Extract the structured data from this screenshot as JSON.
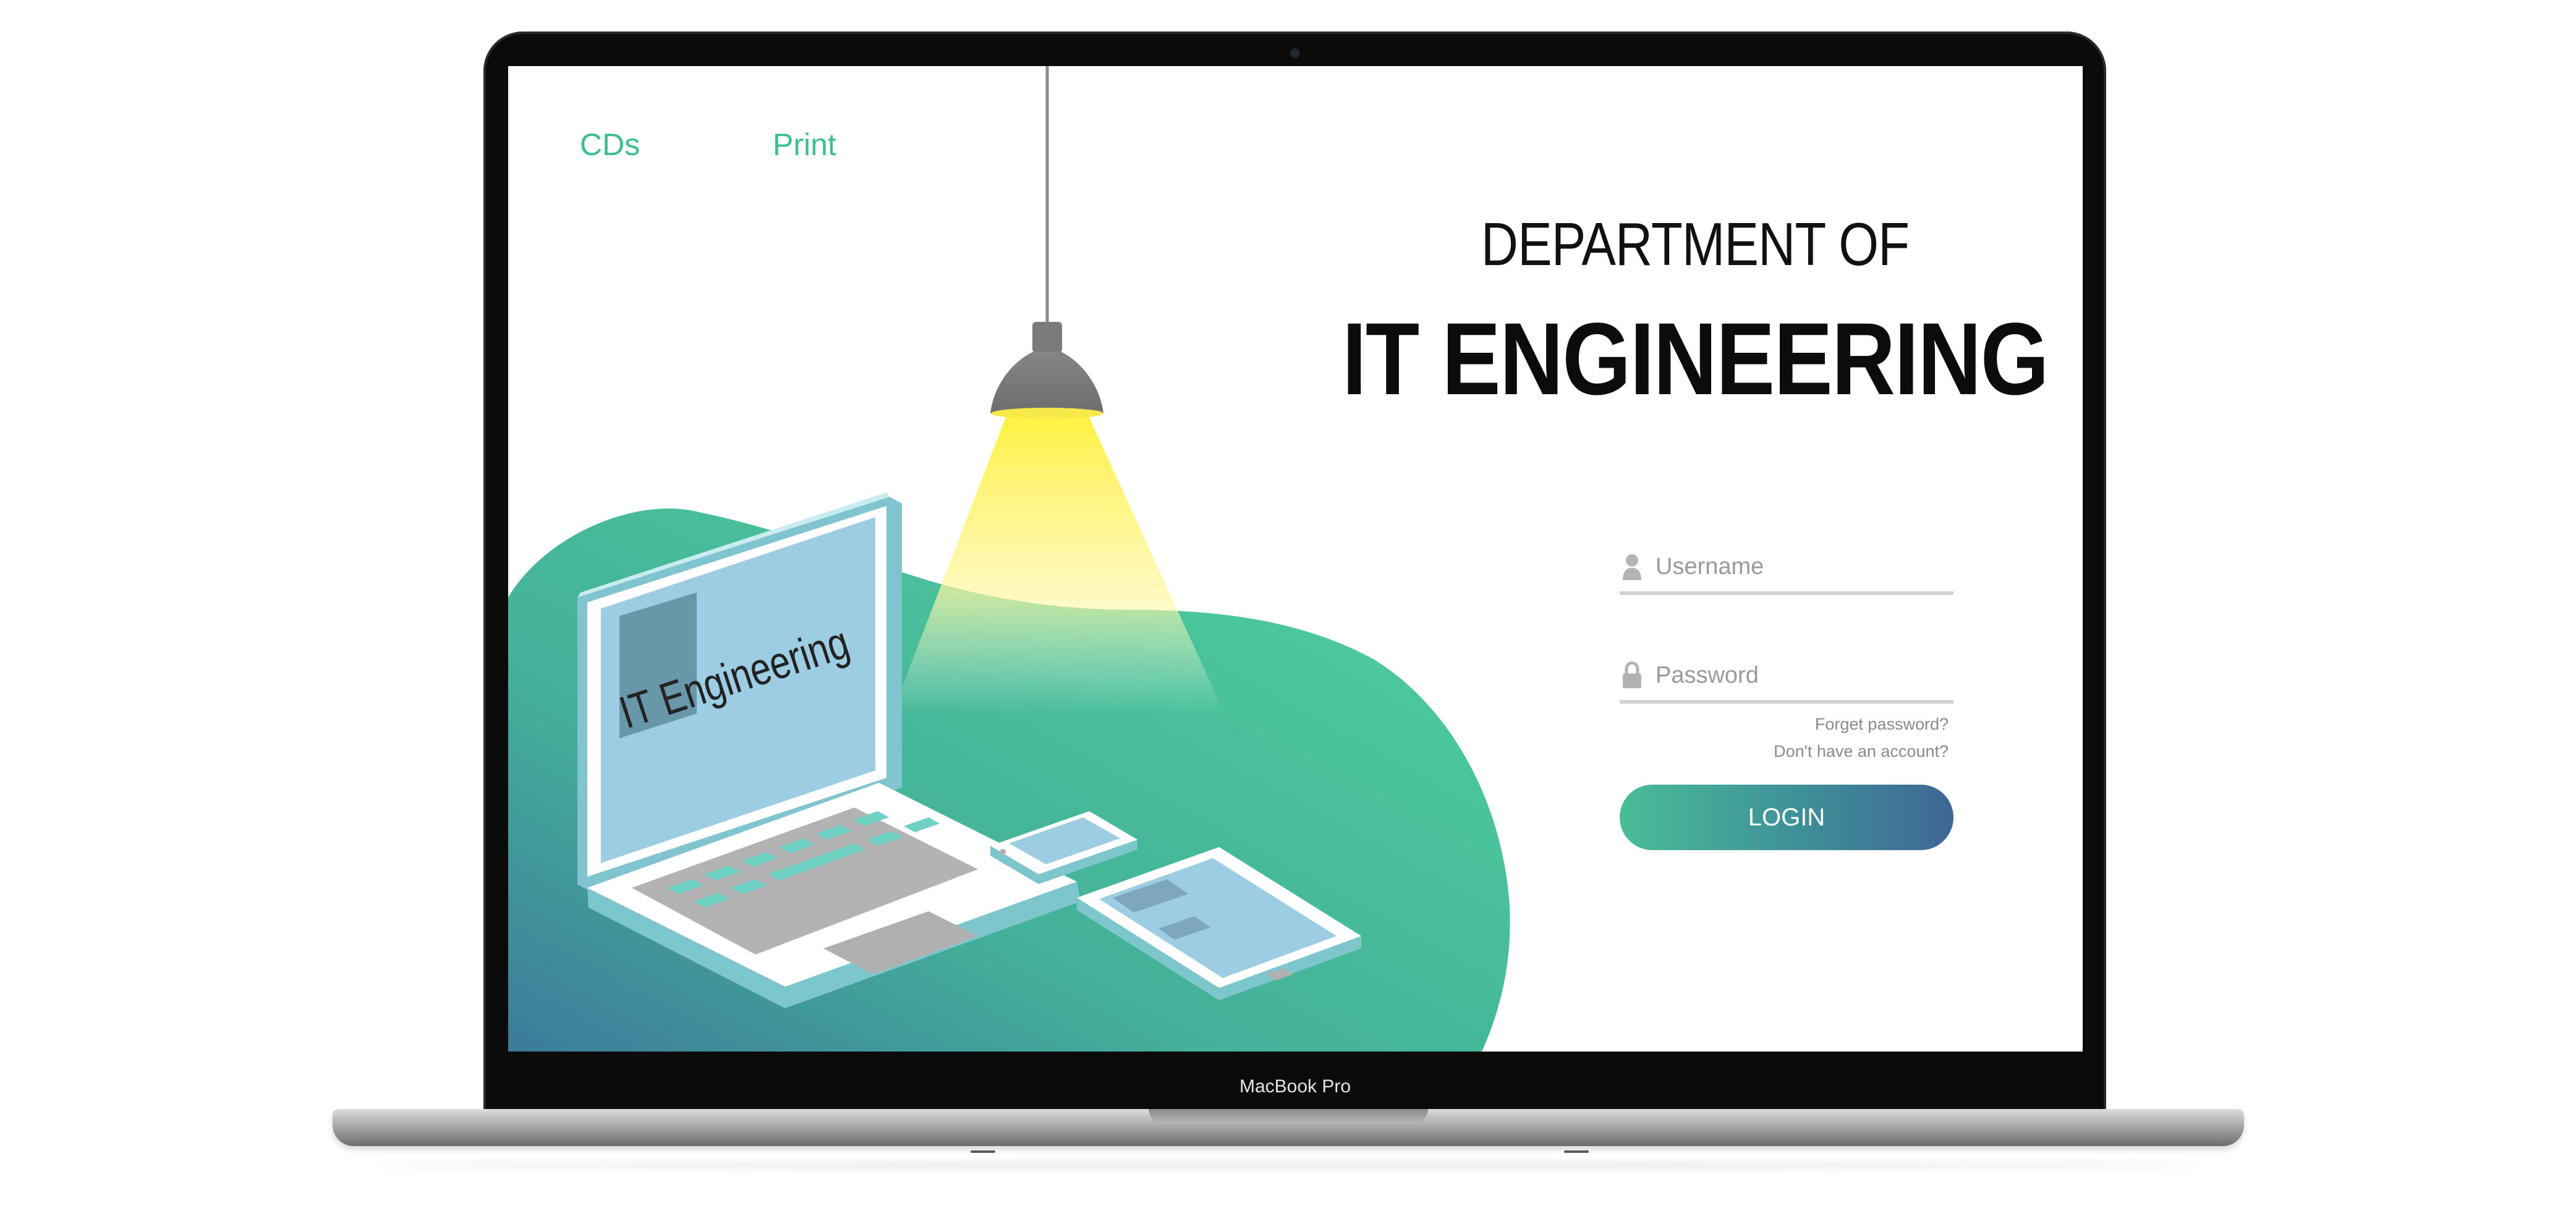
{
  "nav": {
    "links": [
      "CDs",
      "Print"
    ]
  },
  "illustration": {
    "laptop_screen_text": "IT Engineering"
  },
  "heading": {
    "line1": "DEPARTMENT OF",
    "line2": "IT ENGINEERING"
  },
  "login_form": {
    "username_placeholder": "Username",
    "password_placeholder": "Password",
    "forgot_password": "Forget password?",
    "no_account": "Don't have an account?",
    "login_button": "LOGIN"
  },
  "device": {
    "label": "MacBook Pro"
  },
  "colors": {
    "accent_green": "#3dbf90",
    "blob_green": "#4fcf9c",
    "button_gradient": [
      "#49bd98",
      "#3f6695"
    ],
    "lamp_light": "#fff27a"
  },
  "icons": [
    "user-icon",
    "lock-icon",
    "lamp-icon"
  ]
}
